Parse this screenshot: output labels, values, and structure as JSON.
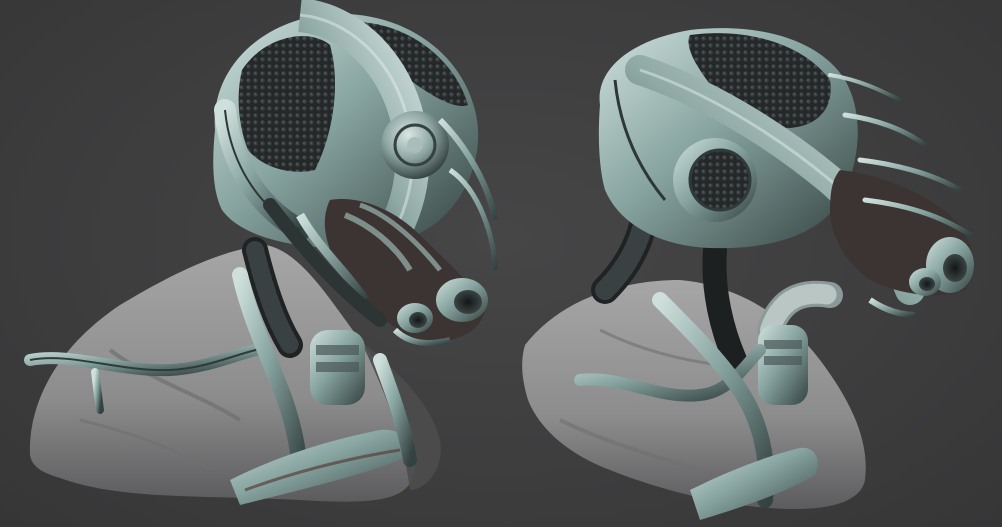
{
  "scene": {
    "description_hidden": "",
    "palette": {
      "background": "#3e3e3f",
      "skin": "#9a9a9a",
      "skin_shadow": "#5e5e60",
      "metal": "#8aa6a3",
      "metal_dark": "#3f4f4e",
      "metal_light": "#c7dad6",
      "mesh": "#2b2f30",
      "rust": "#5a3f3a"
    },
    "views": [
      {
        "id": "three-quarter-view"
      },
      {
        "id": "side-view"
      }
    ]
  }
}
